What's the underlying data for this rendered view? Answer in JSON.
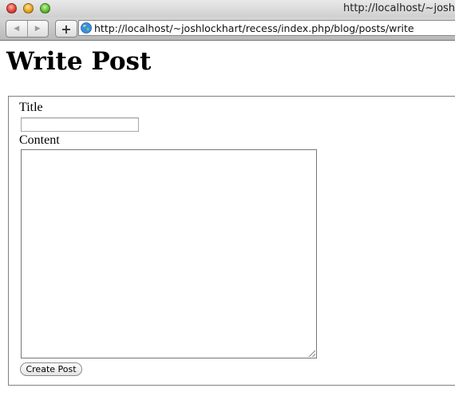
{
  "window": {
    "title": "http://localhost/~josh"
  },
  "toolbar": {
    "back_icon": "back-arrow-icon",
    "forward_icon": "forward-arrow-icon",
    "add_label": "+",
    "url": "http://localhost/~joshlockhart/recess/index.php/blog/posts/write"
  },
  "page": {
    "heading": "Write Post",
    "form": {
      "title_label": "Title",
      "title_value": "",
      "content_label": "Content",
      "content_value": "",
      "submit_label": "Create Post"
    }
  }
}
